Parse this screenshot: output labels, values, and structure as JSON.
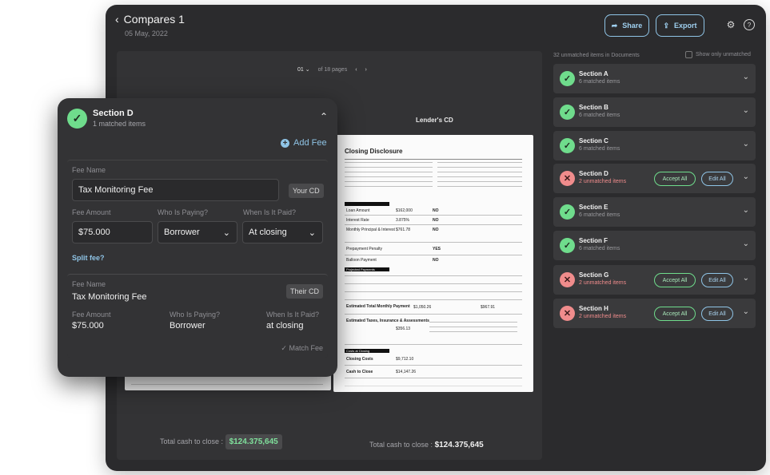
{
  "header": {
    "title": "Compares 1",
    "date": "05 May, 2022",
    "share_label": "Share",
    "export_label": "Export"
  },
  "viewer": {
    "page_current": "01",
    "page_of": "of 18 pages",
    "right_doc_label": "Lender's CD"
  },
  "totals": {
    "left_label": "Total cash to close :",
    "left_value": "$124.375,645",
    "right_label": "Total cash to close :",
    "right_value": "$124.375,645"
  },
  "sidebar": {
    "unmatched_text": "32 unmatched items in Documents",
    "only_unmatched_label": "Show only unmatched",
    "accept_label": "Accept All",
    "edit_label": "Edit All",
    "sections": [
      {
        "name": "Section A",
        "status": "6 matched items",
        "state": "ok"
      },
      {
        "name": "Section B",
        "status": "6 matched items",
        "state": "ok"
      },
      {
        "name": "Section C",
        "status": "6 matched items",
        "state": "ok"
      },
      {
        "name": "Section D",
        "status": "2 unmatched items",
        "state": "bad"
      },
      {
        "name": "Section E",
        "status": "6 matched items",
        "state": "ok"
      },
      {
        "name": "Section F",
        "status": "6 matched items",
        "state": "ok"
      },
      {
        "name": "Section G",
        "status": "2 unmatched items",
        "state": "bad"
      },
      {
        "name": "Section H",
        "status": "2 unmatched items",
        "state": "bad"
      }
    ]
  },
  "popup": {
    "title": "Section D",
    "subtitle": "1 matched items",
    "add_fee_label": "Add Fee",
    "your": {
      "fee_name_label": "Fee Name",
      "fee_name_value": "Tax Monitoring Fee",
      "tag": "Your CD",
      "fee_amount_label": "Fee Amount",
      "fee_amount_value": "$75.000",
      "paying_label": "Who Is Paying?",
      "paying_value": "Borrower",
      "when_label": "When Is It Paid?",
      "when_value": "At closing",
      "split_label": "Split fee?"
    },
    "their": {
      "fee_name_label": "Fee Name",
      "fee_name_value": "Tax Monitoring Fee",
      "tag": "Their CD",
      "fee_amount_label": "Fee Amount",
      "fee_amount_value": "$75.000",
      "paying_label": "Who Is Paying?",
      "paying_value": "Borrower",
      "when_label": "When Is It Paid?",
      "when_value": "at closing",
      "match_label": "Match Fee"
    }
  },
  "doc": {
    "title": "Closing Disclosure",
    "rows": [
      {
        "label": "Loan Amount",
        "value": "$162,000",
        "answer": "NO"
      },
      {
        "label": "Interest Rate",
        "value": "3.875%",
        "answer": "NO"
      },
      {
        "label": "Monthly Principal & Interest",
        "value": "$761.78",
        "answer": "NO"
      },
      {
        "label": "Prepayment Penalty",
        "value": "",
        "answer": "YES"
      },
      {
        "label": "Balloon Payment",
        "value": "",
        "answer": "NO"
      }
    ],
    "payments_header": "Projected Payments",
    "payment_row": {
      "label": "Estimated Total Monthly Payment",
      "a": "$1,050.26",
      "b": "$967.91"
    },
    "escrow": {
      "label": "Estimated Taxes, Insurance & Assessments",
      "value": "$356.13"
    },
    "costs_header": "Costs at Closing",
    "closing_costs": {
      "label": "Closing Costs",
      "value": "$9,712.10"
    },
    "cash_to_close": {
      "label": "Cash to Close",
      "value": "$14,147.26"
    }
  }
}
